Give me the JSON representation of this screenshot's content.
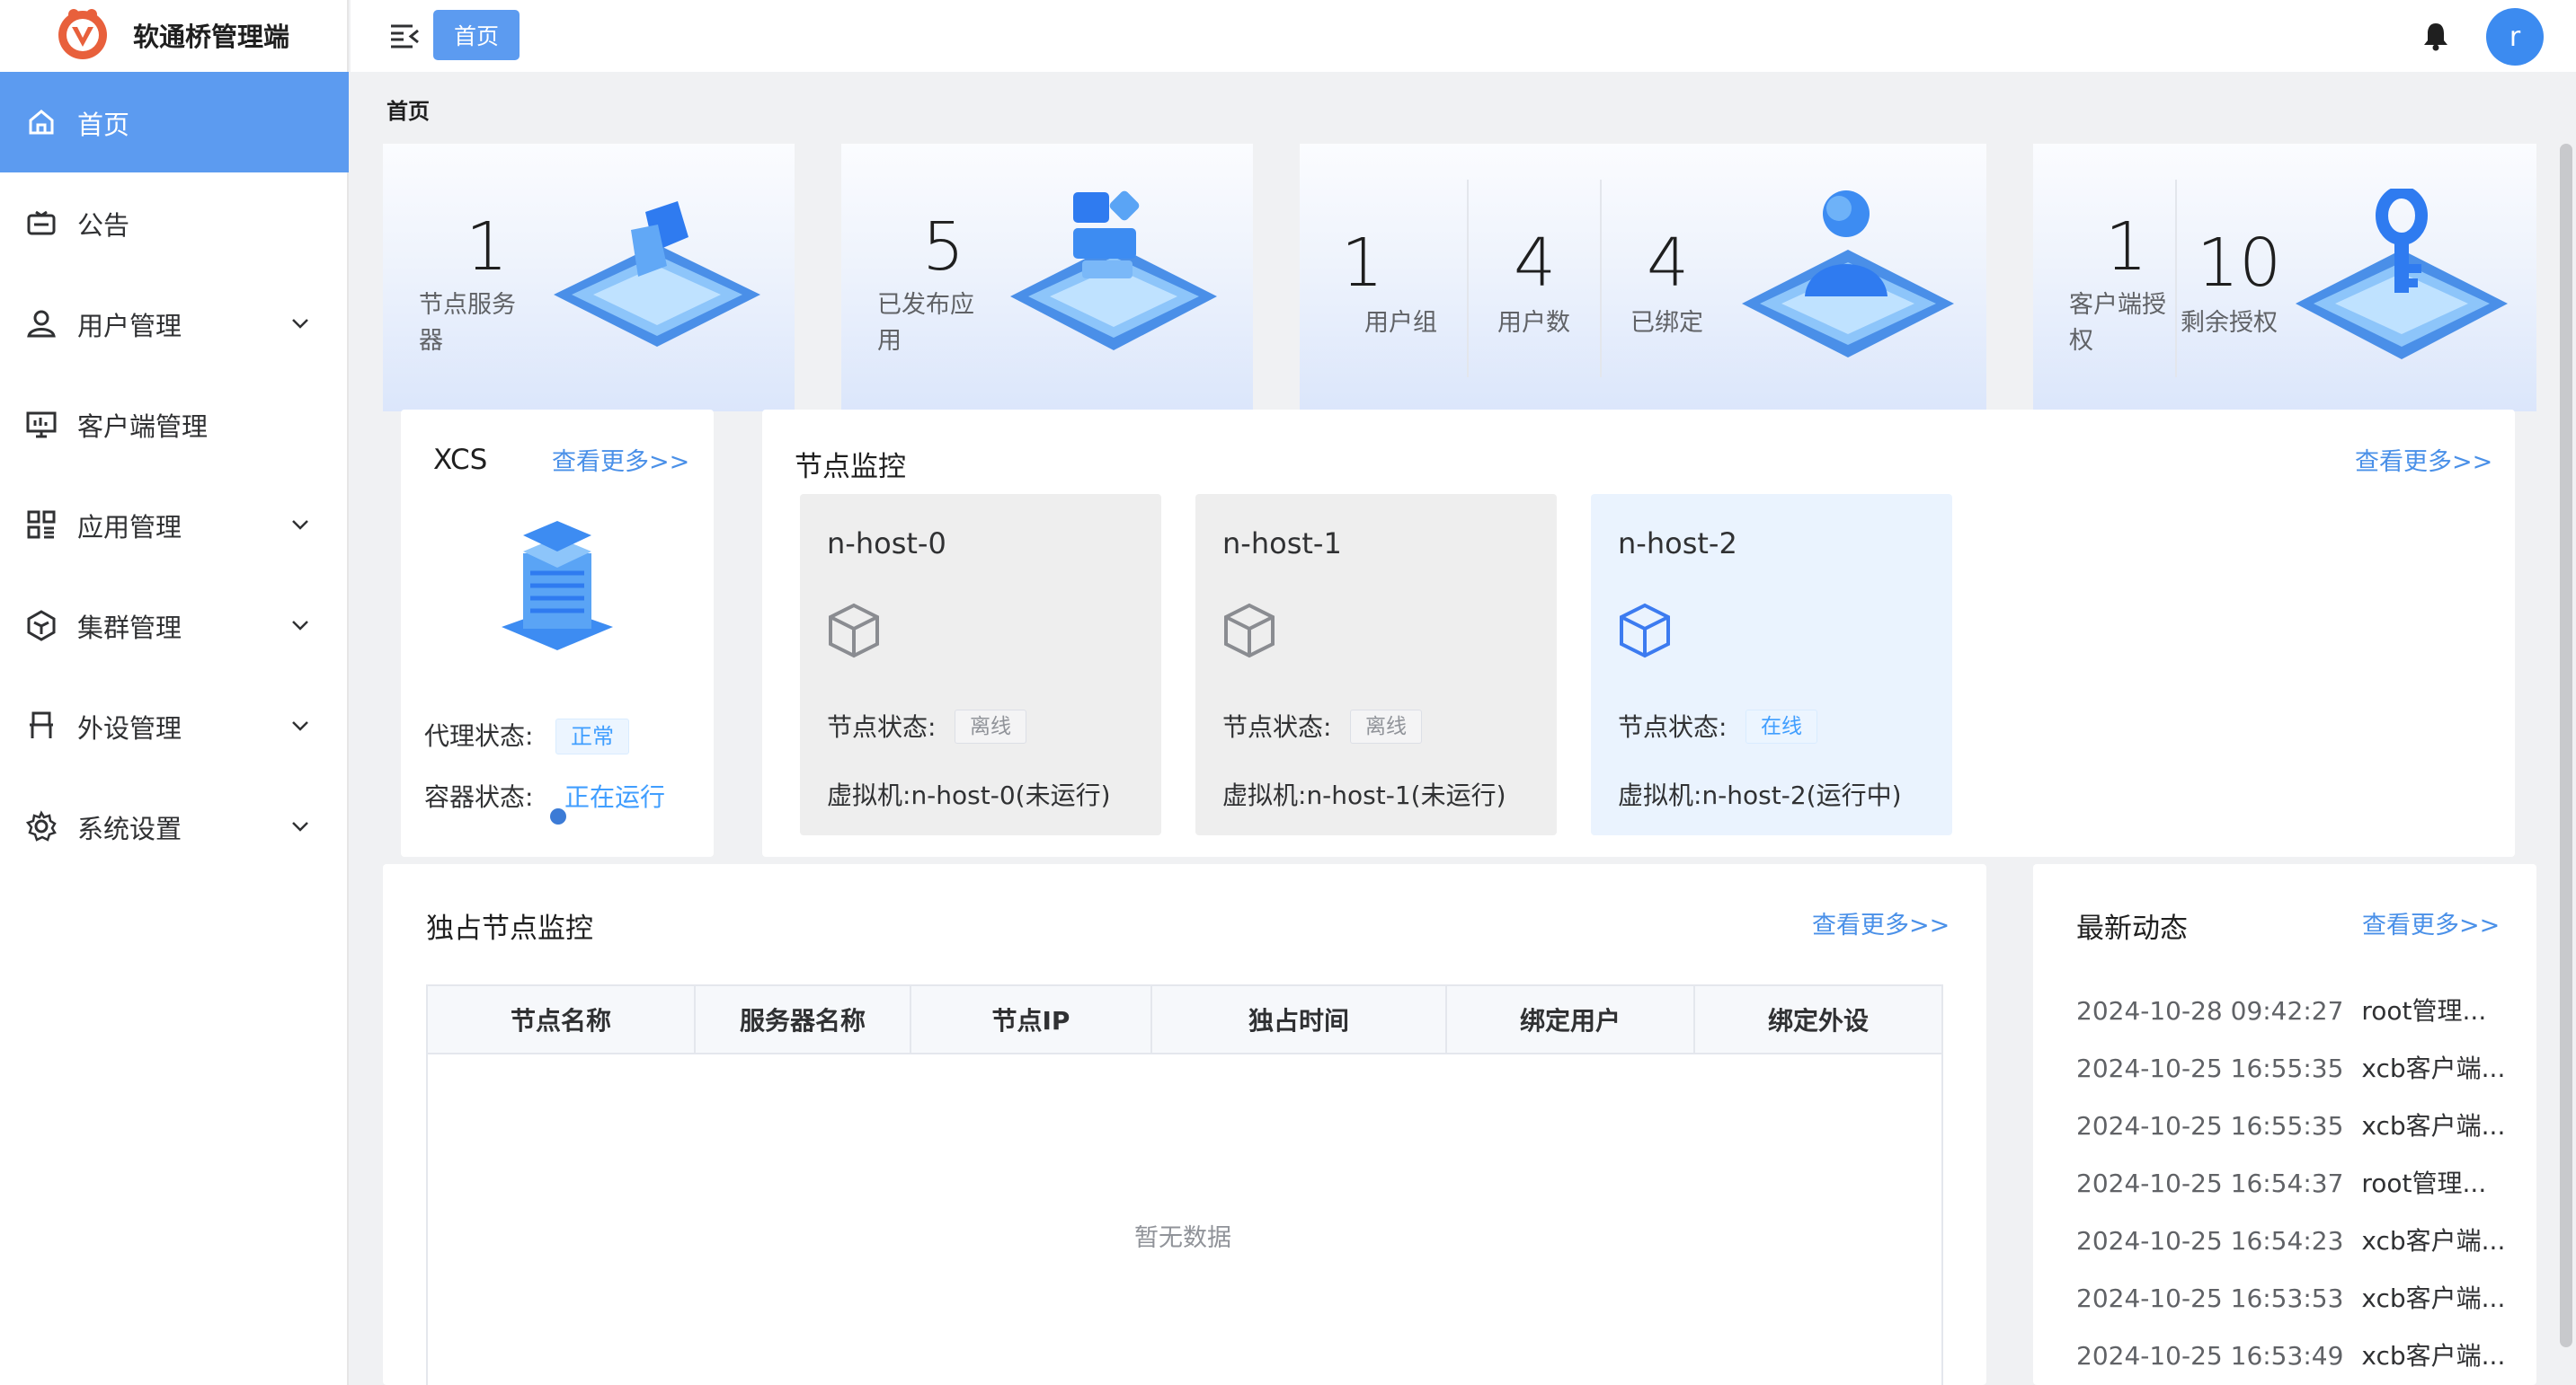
{
  "app": {
    "title": "软通桥管理端"
  },
  "sidebar": {
    "items": [
      {
        "label": "首页",
        "icon": "home-icon",
        "active": true,
        "expandable": false
      },
      {
        "label": "公告",
        "icon": "announcement-icon",
        "expandable": false
      },
      {
        "label": "用户管理",
        "icon": "user-icon",
        "expandable": true
      },
      {
        "label": "客户端管理",
        "icon": "monitor-icon",
        "expandable": false
      },
      {
        "label": "应用管理",
        "icon": "apps-grid-icon",
        "expandable": true
      },
      {
        "label": "集群管理",
        "icon": "cube-icon",
        "expandable": true
      },
      {
        "label": "外设管理",
        "icon": "peripheral-icon",
        "expandable": true
      },
      {
        "label": "系统设置",
        "icon": "gear-icon",
        "expandable": true
      }
    ]
  },
  "header": {
    "tag": "首页",
    "avatar_letter": "r"
  },
  "breadcrumb": "首页",
  "stats": {
    "node_servers": {
      "value": "1",
      "label_line1": "节点服务",
      "label_line2": "器"
    },
    "published_apps": {
      "value": "5",
      "label_line1": "已发布应",
      "label_line2": "用"
    },
    "user_groups": {
      "value": "1",
      "label": "用户组"
    },
    "users": {
      "value": "4",
      "label": "用户数"
    },
    "bound": {
      "value": "4",
      "label": "已绑定"
    },
    "client_auth": {
      "value": "1",
      "label_line1": "客户端授",
      "label_line2": "权"
    },
    "remaining_auth": {
      "value": "10",
      "label": "剩余授权"
    }
  },
  "xcs": {
    "title": "XCS",
    "more": "查看更多>>",
    "proxy_label": "代理状态:",
    "proxy_status": "正常",
    "container_label": "容器状态:",
    "container_status": "正在运行"
  },
  "node_monitor": {
    "title": "节点监控",
    "more": "查看更多>>",
    "status_label": "节点状态:",
    "vm_label": "虚拟机:",
    "nodes": [
      {
        "name": "n-host-0",
        "status": "离线",
        "vm": "n-host-0(未运行)",
        "online": false
      },
      {
        "name": "n-host-1",
        "status": "离线",
        "vm": "n-host-1(未运行)",
        "online": false
      },
      {
        "name": "n-host-2",
        "status": "在线",
        "vm": "n-host-2(运行中)",
        "online": true
      }
    ]
  },
  "exclusive": {
    "title": "独占节点监控",
    "more": "查看更多>>",
    "columns": [
      "节点名称",
      "服务器名称",
      "节点IP",
      "独占时间",
      "绑定用户",
      "绑定外设"
    ],
    "empty_text": "暂无数据"
  },
  "activity": {
    "title": "最新动态",
    "more": "查看更多>>",
    "items": [
      {
        "time": "2024-10-28 09:42:27",
        "text": "root管理..."
      },
      {
        "time": "2024-10-25 16:55:35",
        "text": "xcb客户端..."
      },
      {
        "time": "2024-10-25 16:55:35",
        "text": "xcb客户端..."
      },
      {
        "time": "2024-10-25 16:54:37",
        "text": "root管理..."
      },
      {
        "time": "2024-10-25 16:54:23",
        "text": "xcb客户端..."
      },
      {
        "time": "2024-10-25 16:53:53",
        "text": "xcb客户端..."
      },
      {
        "time": "2024-10-25 16:53:49",
        "text": "xcb客户端..."
      }
    ]
  },
  "colors": {
    "accent": "#5c9bf0",
    "link": "#4a90e8",
    "online": "#409eff"
  }
}
